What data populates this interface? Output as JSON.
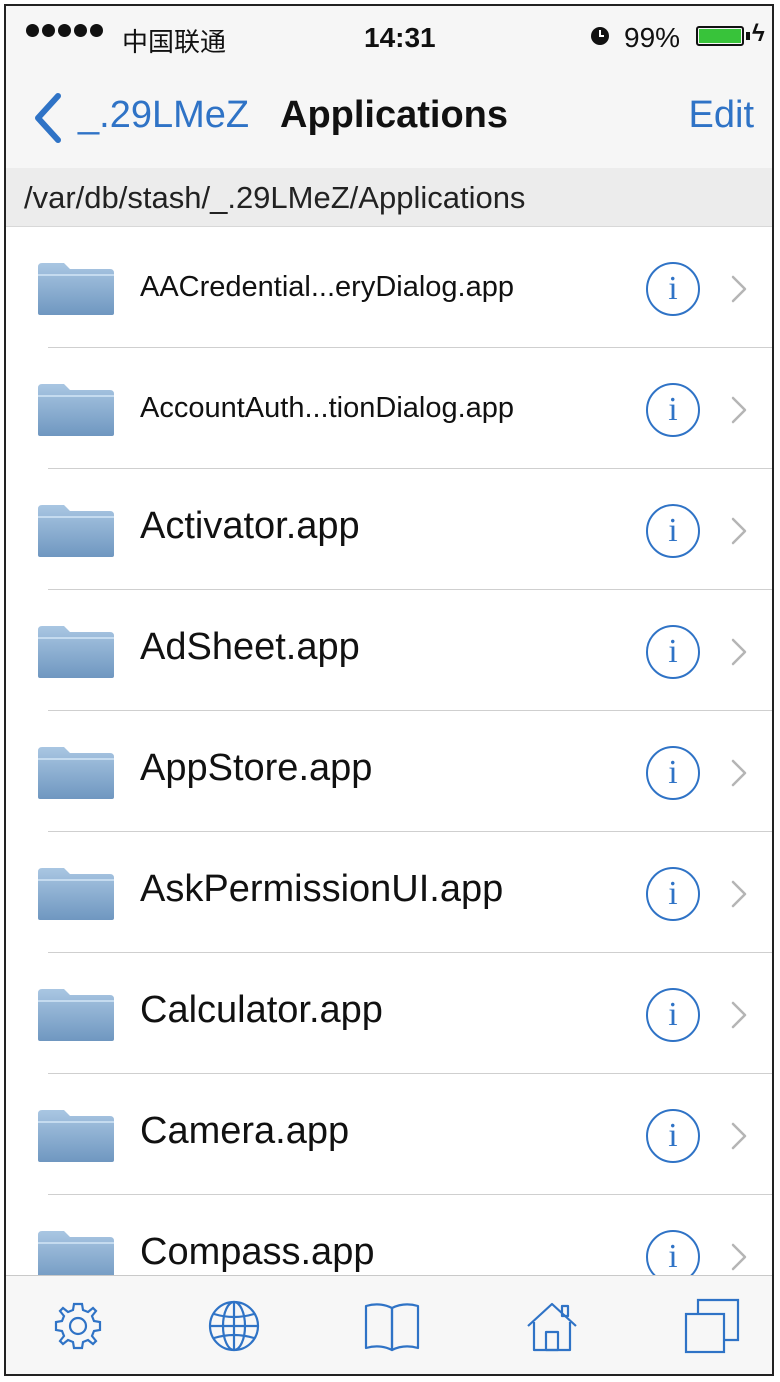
{
  "status_bar": {
    "carrier": "中国联通",
    "time": "14:31",
    "battery": "99%",
    "signal_icon": "signal-dots-icon",
    "alarm_icon": "alarm-icon",
    "battery_icon": "battery-charging-icon"
  },
  "nav": {
    "back_label": "_.29LMeZ",
    "title": "Applications",
    "edit_label": "Edit"
  },
  "path": "/var/db/stash/_.29LMeZ/Applications",
  "items": [
    {
      "name": "AACredential...eryDialog.app"
    },
    {
      "name": "AccountAuth...tionDialog.app"
    },
    {
      "name": "Activator.app"
    },
    {
      "name": "AdSheet.app"
    },
    {
      "name": "AppStore.app"
    },
    {
      "name": "AskPermissionUI.app"
    },
    {
      "name": "Calculator.app"
    },
    {
      "name": "Camera.app"
    },
    {
      "name": "Compass.app"
    }
  ],
  "row_icons": {
    "folder": "folder-icon",
    "info": "info-icon",
    "chevron": "chevron-right-icon"
  },
  "tabbar": [
    "gear-icon",
    "globe-icon",
    "book-icon",
    "home-icon",
    "windows-icon"
  ],
  "colors": {
    "accent": "#2f73c6",
    "battery": "#38c33a",
    "folder": "#8fb2d4"
  }
}
